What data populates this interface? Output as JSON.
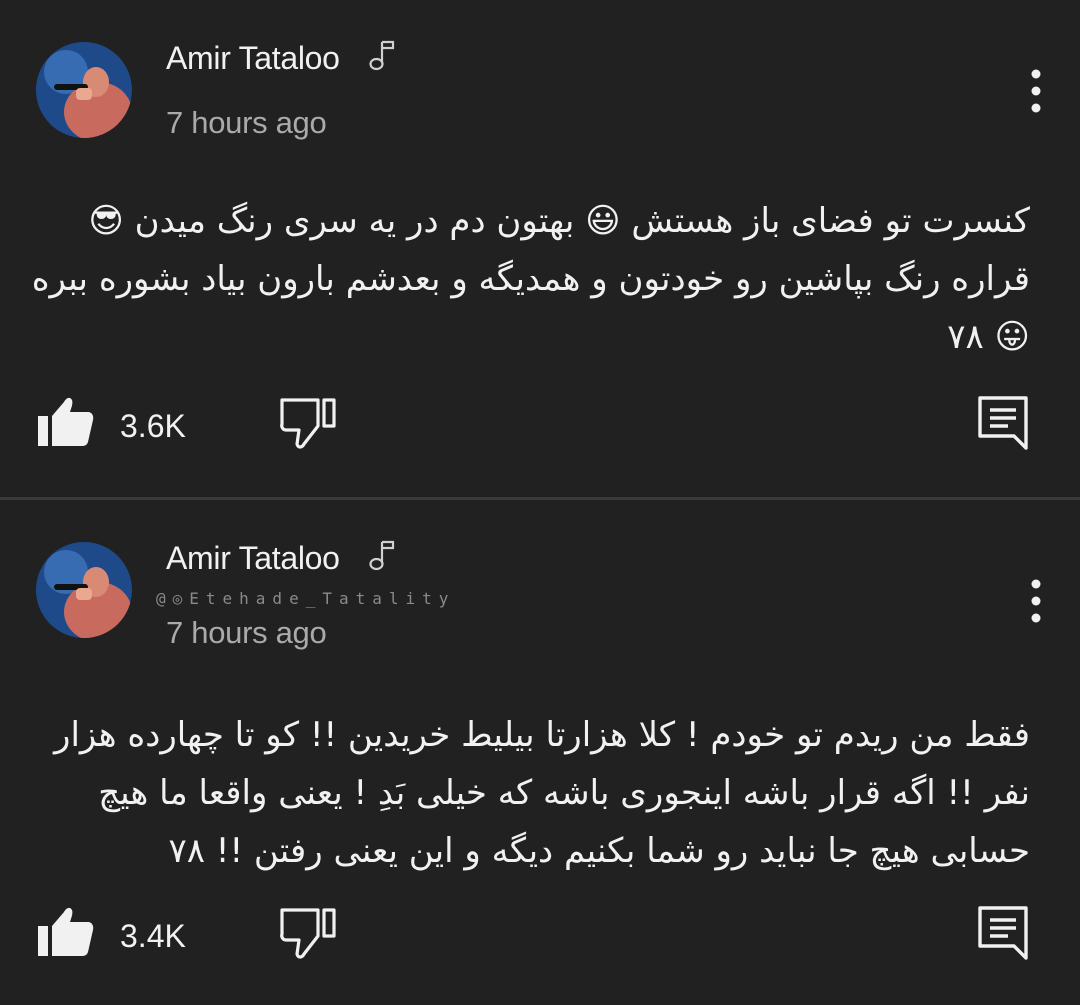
{
  "posts": [
    {
      "author": "Amir Tataloo",
      "timestamp": "7 hours ago",
      "text": "کنسرت تو فضای باز هستش 😃 بهتون دم در یه سری رنگ میدن 😎 قراره رنگ بپاشین رو خودتون و همدیگه و بعدشم بارون بیاد بشوره ببره 😛 ۷۸",
      "likes": "3.6K",
      "icons": {
        "author_badge": "music-note-icon",
        "menu": "more-vertical-icon",
        "like": "thumbs-up-icon",
        "dislike": "thumbs-down-icon",
        "comment": "comment-icon"
      }
    },
    {
      "author": "Amir Tataloo",
      "watermark": "@◎Etehade_Tatality",
      "timestamp": "7 hours ago",
      "text": "فقط من ریدم تو خودم ! کلا هزارتا بیلیط خریدین !! کو تا چهارده هزار نفر !! اگه قرار باشه اینجوری باشه که خیلی بَدِ ! یعنی واقعا ما هیچ حسابی هیچ جا نباید رو شما بکنیم دیگه و این یعنی رفتن !! ۷۸",
      "likes": "3.4K",
      "icons": {
        "author_badge": "music-note-icon",
        "menu": "more-vertical-icon",
        "like": "thumbs-up-icon",
        "dislike": "thumbs-down-icon",
        "comment": "comment-icon"
      }
    }
  ],
  "colors": {
    "background": "#212121",
    "primary_text": "#f1f1f1",
    "secondary_text": "#aaaaaa",
    "divider": "#3a3a3a"
  }
}
